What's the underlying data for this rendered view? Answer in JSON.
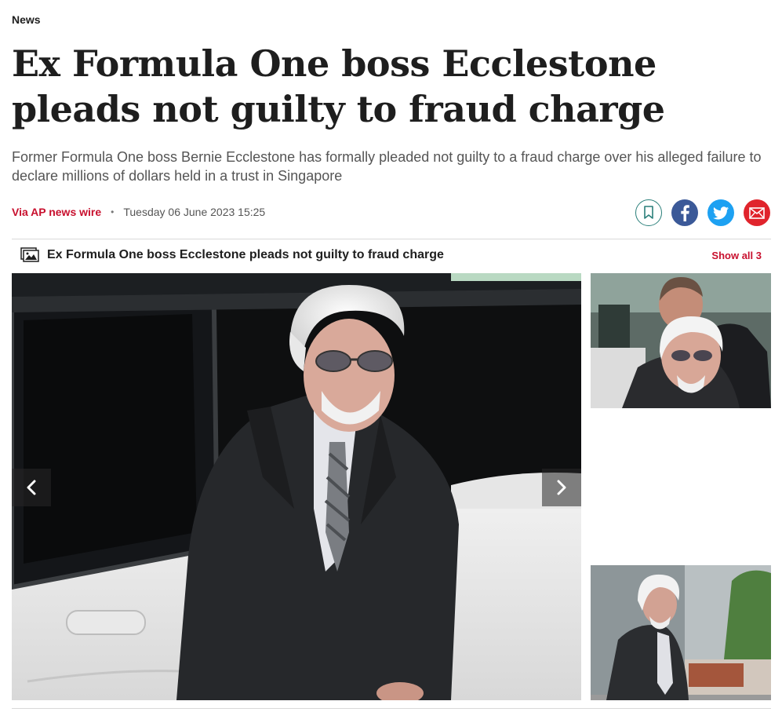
{
  "section": "News",
  "headline": "Ex Formula One boss Ecclestone pleads not guilty to fraud charge",
  "standfirst": "Former Formula One boss Bernie Ecclestone has formally pleaded not guilty to a fraud charge over his alleged failure to declare millions of dollars held in a trust in Singapore",
  "byline": {
    "author": "Via AP news wire",
    "separator": "•",
    "date": "Tuesday 06 June 2023 15:25"
  },
  "share": {
    "icons": [
      "bookmark-icon",
      "facebook-icon",
      "twitter-icon",
      "email-icon"
    ],
    "colors": {
      "bookmark": "#2a7f7a",
      "facebook": "#3b5998",
      "twitter": "#1da1f2",
      "email": "#e0242c"
    }
  },
  "gallery": {
    "title": "Ex Formula One boss Ecclestone pleads not guilty to fraud charge",
    "show_all": "Show all 3",
    "icon": "gallery-icon"
  },
  "colors": {
    "accent": "#c8102e",
    "text": "#1e1e1e",
    "muted": "#555555"
  }
}
